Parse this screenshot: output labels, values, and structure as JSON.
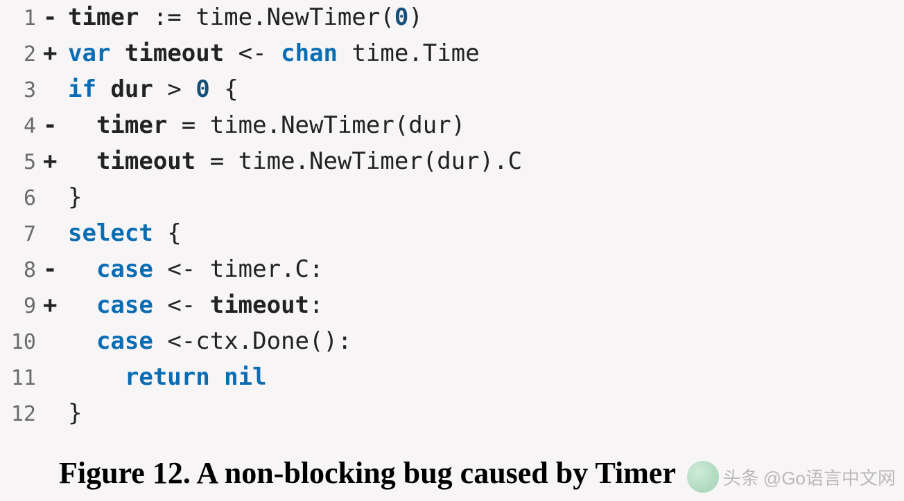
{
  "code": {
    "lines": [
      {
        "n": "1",
        "diff": "-",
        "indent": "",
        "tokens": [
          [
            "id",
            "timer"
          ],
          [
            "plain",
            " := time.NewTimer("
          ],
          [
            "num",
            "0"
          ],
          [
            "plain",
            ")"
          ]
        ]
      },
      {
        "n": "2",
        "diff": "+",
        "indent": "",
        "tokens": [
          [
            "kw",
            "var"
          ],
          [
            "plain",
            " "
          ],
          [
            "id",
            "timeout"
          ],
          [
            "plain",
            " <- "
          ],
          [
            "kw",
            "chan"
          ],
          [
            "plain",
            " time.Time"
          ]
        ]
      },
      {
        "n": "3",
        "diff": " ",
        "indent": "",
        "tokens": [
          [
            "kw",
            "if"
          ],
          [
            "plain",
            " "
          ],
          [
            "id",
            "dur"
          ],
          [
            "plain",
            " > "
          ],
          [
            "num",
            "0"
          ],
          [
            "plain",
            " {"
          ]
        ]
      },
      {
        "n": "4",
        "diff": "-",
        "indent": "  ",
        "tokens": [
          [
            "id",
            "timer"
          ],
          [
            "plain",
            " = time.NewTimer(dur)"
          ]
        ]
      },
      {
        "n": "5",
        "diff": "+",
        "indent": "  ",
        "tokens": [
          [
            "id",
            "timeout"
          ],
          [
            "plain",
            " = time.NewTimer(dur).C"
          ]
        ]
      },
      {
        "n": "6",
        "diff": " ",
        "indent": "",
        "tokens": [
          [
            "plain",
            "}"
          ]
        ]
      },
      {
        "n": "7",
        "diff": " ",
        "indent": "",
        "tokens": [
          [
            "kw",
            "select"
          ],
          [
            "plain",
            " {"
          ]
        ]
      },
      {
        "n": "8",
        "diff": "-",
        "indent": "  ",
        "tokens": [
          [
            "kw",
            "case"
          ],
          [
            "plain",
            " <- timer.C:"
          ]
        ]
      },
      {
        "n": "9",
        "diff": "+",
        "indent": "  ",
        "tokens": [
          [
            "kw",
            "case"
          ],
          [
            "plain",
            " <- "
          ],
          [
            "id",
            "timeout"
          ],
          [
            "plain",
            ":"
          ]
        ]
      },
      {
        "n": "10",
        "diff": " ",
        "indent": "  ",
        "tokens": [
          [
            "kw",
            "case"
          ],
          [
            "plain",
            " <-ctx.Done():"
          ]
        ]
      },
      {
        "n": "11",
        "diff": " ",
        "indent": "    ",
        "tokens": [
          [
            "kw",
            "return nil"
          ]
        ]
      },
      {
        "n": "12",
        "diff": " ",
        "indent": "",
        "tokens": [
          [
            "plain",
            "}"
          ]
        ]
      }
    ]
  },
  "caption": "Figure 12. A non-blocking bug caused by Timer",
  "watermark": {
    "prefix": "头条",
    "text": "@Go语言中文网"
  }
}
